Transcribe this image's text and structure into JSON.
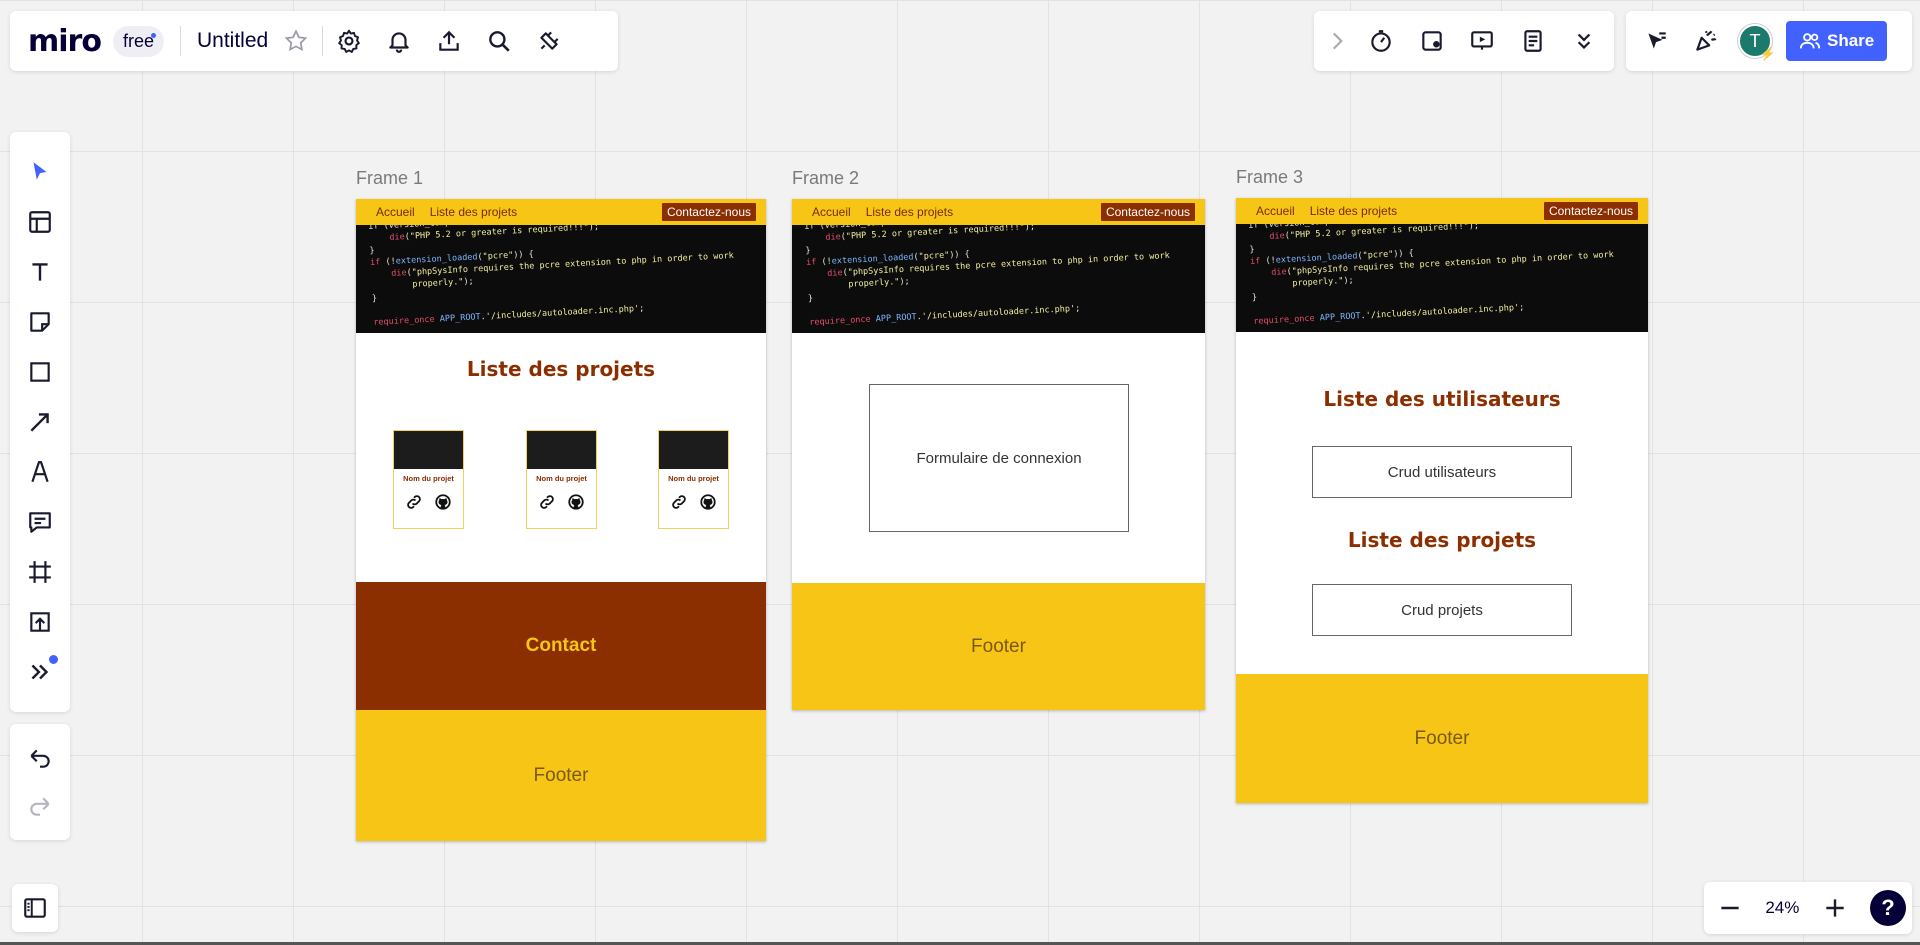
{
  "app": {
    "logo": "miro",
    "plan": "free",
    "board_title": "Untitled",
    "share_label": "Share",
    "avatar_initial": "T",
    "zoom": "24%",
    "help": "?",
    "accent": "#4262ff"
  },
  "top_toolbar_icons": [
    "settings-icon",
    "bell-icon",
    "upload-icon",
    "search-icon",
    "plug-icon"
  ],
  "app_icons": [
    "chevron-right-icon",
    "timer-icon",
    "voting-icon",
    "presentation-icon",
    "notes-icon",
    "chevrons-down-icon"
  ],
  "left_tools": [
    "select-icon",
    "templates-icon",
    "text-icon",
    "sticky-note-icon",
    "shape-icon",
    "arrow-icon",
    "pen-icon",
    "comment-icon",
    "frame-icon",
    "upload-icon",
    "more-tools-icon"
  ],
  "frames": [
    {
      "label": "Frame 1",
      "nav": {
        "home": "Accueil",
        "projects": "Liste des projets",
        "contact": "Contactez-nous"
      },
      "title": "Liste des projets",
      "cards": [
        {
          "name": "Nom du projet"
        },
        {
          "name": "Nom du projet"
        },
        {
          "name": "Nom du projet"
        }
      ],
      "contact": "Contact",
      "footer": "Footer"
    },
    {
      "label": "Frame 2",
      "nav": {
        "home": "Accueil",
        "projects": "Liste des projets",
        "contact": "Contactez-nous"
      },
      "login_box": "Formulaire de connexion",
      "footer": "Footer"
    },
    {
      "label": "Frame 3",
      "nav": {
        "home": "Accueil",
        "projects": "Liste des projets",
        "contact": "Contactez-nous"
      },
      "users_title": "Liste des utilisateurs",
      "users_box": "Crud utilisateurs",
      "projects_title": "Liste des projets",
      "projects_box": "Crud projets",
      "footer": "Footer"
    }
  ],
  "colors": {
    "yellow": "#f7c516",
    "brown": "#8b2e00",
    "code_bg": "#0c0c0c"
  }
}
